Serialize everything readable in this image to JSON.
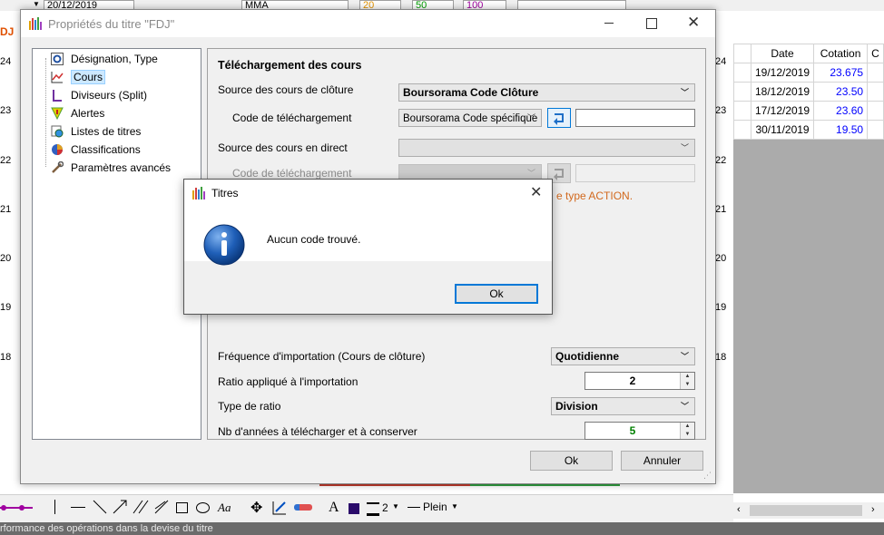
{
  "background": {
    "toolbar_date": "20/12/2019",
    "toolbar_indicator": "MMA",
    "toolbar_p1": "20",
    "toolbar_p2": "50",
    "toolbar_p3": "100",
    "left_label": "DJ",
    "y_axis": [
      "24",
      "23",
      "22",
      "21",
      "20",
      "19",
      "18"
    ],
    "y_axis_right": [
      "24",
      "23",
      "22",
      "21",
      "20",
      "19",
      "18"
    ],
    "grid": {
      "headers": [
        "Date",
        "Cotation",
        "C"
      ],
      "rows": [
        {
          "date": "19/12/2019",
          "cotation": "23.675"
        },
        {
          "date": "18/12/2019",
          "cotation": "23.50"
        },
        {
          "date": "17/12/2019",
          "cotation": "23.60"
        },
        {
          "date": "30/11/2019",
          "cotation": "19.50"
        }
      ]
    },
    "line_width_value": "2",
    "line_style": "Plein",
    "status_text": "rformance des opérations dans la devise du titre"
  },
  "dialog": {
    "title": "Propriétés du titre \"FDJ\"",
    "tree": [
      {
        "label": "Désignation, Type",
        "icon": "gear-icon"
      },
      {
        "label": "Cours",
        "icon": "chart-line-icon"
      },
      {
        "label": "Diviseurs (Split)",
        "icon": "split-icon"
      },
      {
        "label": "Alertes",
        "icon": "alert-funnel-icon"
      },
      {
        "label": "Listes de titres",
        "icon": "list-globe-icon"
      },
      {
        "label": "Classifications",
        "icon": "pie-chart-icon"
      },
      {
        "label": "Paramètres avancés",
        "icon": "tools-icon"
      }
    ],
    "section_title": "Téléchargement des cours",
    "source_cloture_label": "Source des cours de clôture",
    "source_cloture_value": "Boursorama Code Clôture",
    "code_telechargement_label": "Code de téléchargement",
    "code_telechargement_value": "Boursorama Code spécifique",
    "source_direct_label": "Source des cours en direct",
    "code_telechargement2_label": "Code de téléchargement",
    "warning_partial": "e type ACTION.",
    "frequence_label": "Fréquence d'importation (Cours de clôture)",
    "frequence_value": "Quotidienne",
    "ratio_label": "Ratio appliqué à l'importation",
    "ratio_value": "2",
    "type_ratio_label": "Type de ratio",
    "type_ratio_value": "Division",
    "nb_annees_label": "Nb d'années à télécharger et à conserver",
    "nb_annees_value": "5",
    "ok_label": "Ok",
    "cancel_label": "Annuler"
  },
  "messagebox": {
    "title": "Titres",
    "message": "Aucun code trouvé.",
    "ok_label": "Ok"
  },
  "colors": {
    "accent": "#0078d7",
    "warning": "#d2691e",
    "cotation": "#0000ff",
    "green_value": "#008000"
  }
}
